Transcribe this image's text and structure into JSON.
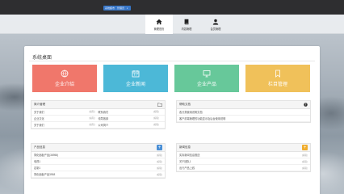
{
  "topbar": {
    "user_name": "系统超市",
    "user_role": "管理员"
  },
  "nav": {
    "items": [
      {
        "label": "管理首页",
        "icon": "home-icon",
        "active": true
      },
      {
        "label": "内容管理",
        "icon": "book-icon",
        "active": false
      },
      {
        "label": "会员管理",
        "icon": "user-icon",
        "active": false
      }
    ]
  },
  "desk": {
    "title": "系统桌面"
  },
  "tiles": [
    {
      "label": "企业介绍",
      "icon": "globe-icon",
      "color": "#f0776b"
    },
    {
      "label": "企业新闻",
      "icon": "calendar-icon",
      "color": "#4cb8d7"
    },
    {
      "label": "企业产品",
      "icon": "monitor-icon",
      "color": "#67c89a"
    },
    {
      "label": "栏目管理",
      "icon": "bookmark-icon",
      "color": "#f0c15a"
    }
  ],
  "intro_box": {
    "title": "简介管理",
    "edit_label": "[编辑]",
    "rows": [
      [
        "关于我们",
        "联系我们"
      ],
      [
        "企业文化",
        "领导致辞"
      ],
      [
        "关于我们",
        "公司简介"
      ]
    ]
  },
  "help_box": {
    "title": "帮助文档",
    "rows": [
      "各分类使用说明文档",
      "客户前端管理的功能显示及后台使用说明"
    ]
  },
  "product_box": {
    "title": "产品信息",
    "edit_label": "[编辑]",
    "rows": [
      "简化面板产品(38958)",
      "电视1",
      "定制1",
      "简化面板产品3958"
    ]
  },
  "news_box": {
    "title": "新闻信息",
    "edit_label": "[编辑]",
    "rows": [
      "实际新闻信息推送",
      "关于团队1",
      "出行产品上线"
    ]
  },
  "colors": {
    "topbar": "#2e2e30",
    "accent": "#3877c8",
    "plus_blue": "#4a8fd6",
    "plus_orange": "#f0ad2e"
  }
}
